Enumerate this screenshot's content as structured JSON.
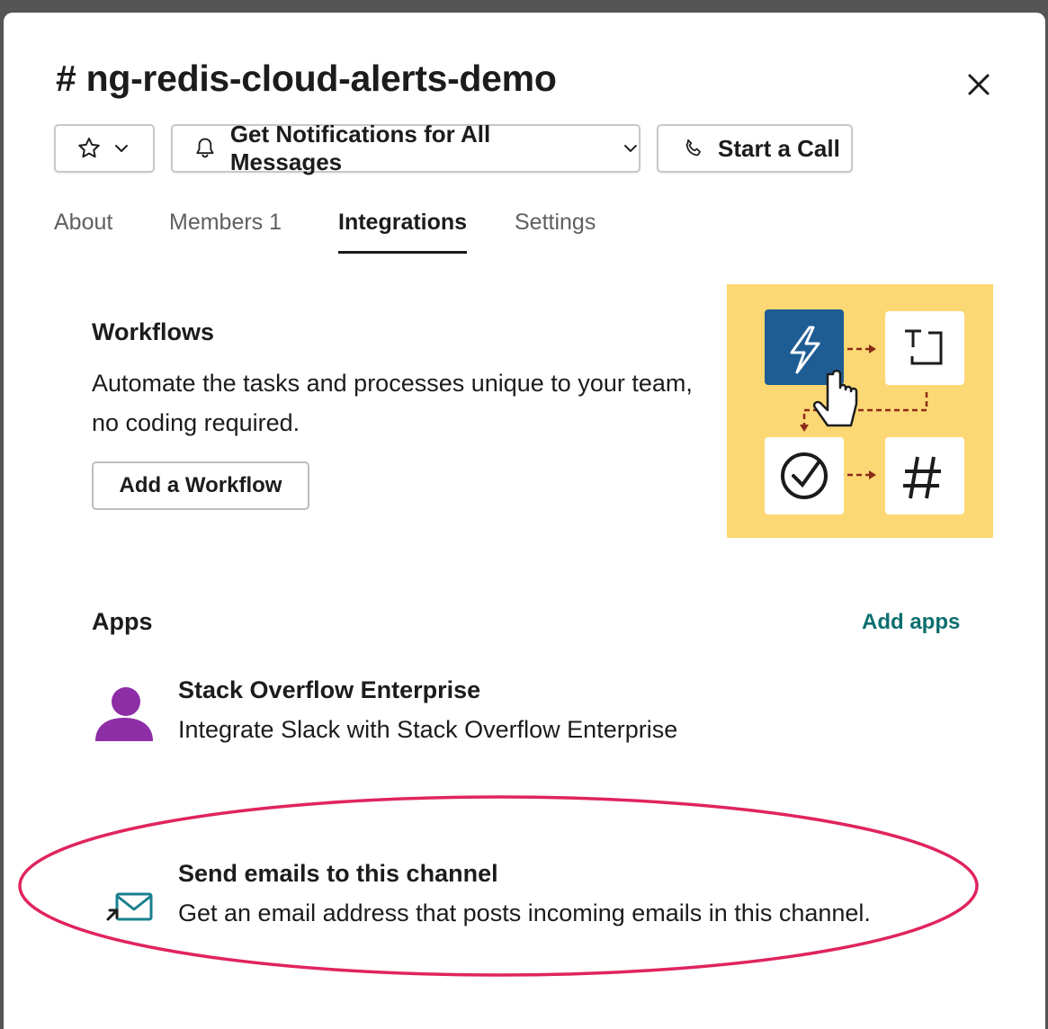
{
  "modal": {
    "title": "# ng-redis-cloud-alerts-demo",
    "close_icon": "close-icon"
  },
  "toolbar": {
    "star_icon": "star-icon",
    "star_dropdown_icon": "chevron-down-icon",
    "notifications_label": "Get Notifications for All Messages",
    "notifications_icon": "bell-icon",
    "call_label": "Start a Call",
    "call_icon": "phone-icon"
  },
  "tabs": [
    {
      "label": "About",
      "active": false
    },
    {
      "label": "Members 1",
      "active": false
    },
    {
      "label": "Integrations",
      "active": true
    },
    {
      "label": "Settings",
      "active": false
    }
  ],
  "workflows": {
    "title": "Workflows",
    "description": "Automate the tasks and processes unique to your team, no coding required.",
    "button_label": "Add a Workflow",
    "illustration": "workflow-illustration"
  },
  "apps": {
    "title": "Apps",
    "add_label": "Add apps",
    "items": [
      {
        "name": "Stack Overflow Enterprise",
        "description": "Integrate Slack with Stack Overflow Enterprise",
        "icon": "user-avatar-icon"
      },
      {
        "name": "Send emails to this channel",
        "description": "Get an email address that posts incoming emails in this channel.",
        "icon": "email-forward-icon"
      }
    ]
  },
  "colors": {
    "accent_link": "#0d6e6e",
    "illustration_bg": "#fbd873",
    "workflow_blue": "#1e5c94",
    "avatar_purple": "#8e2ea6",
    "highlight_ring": "#e0245e"
  }
}
